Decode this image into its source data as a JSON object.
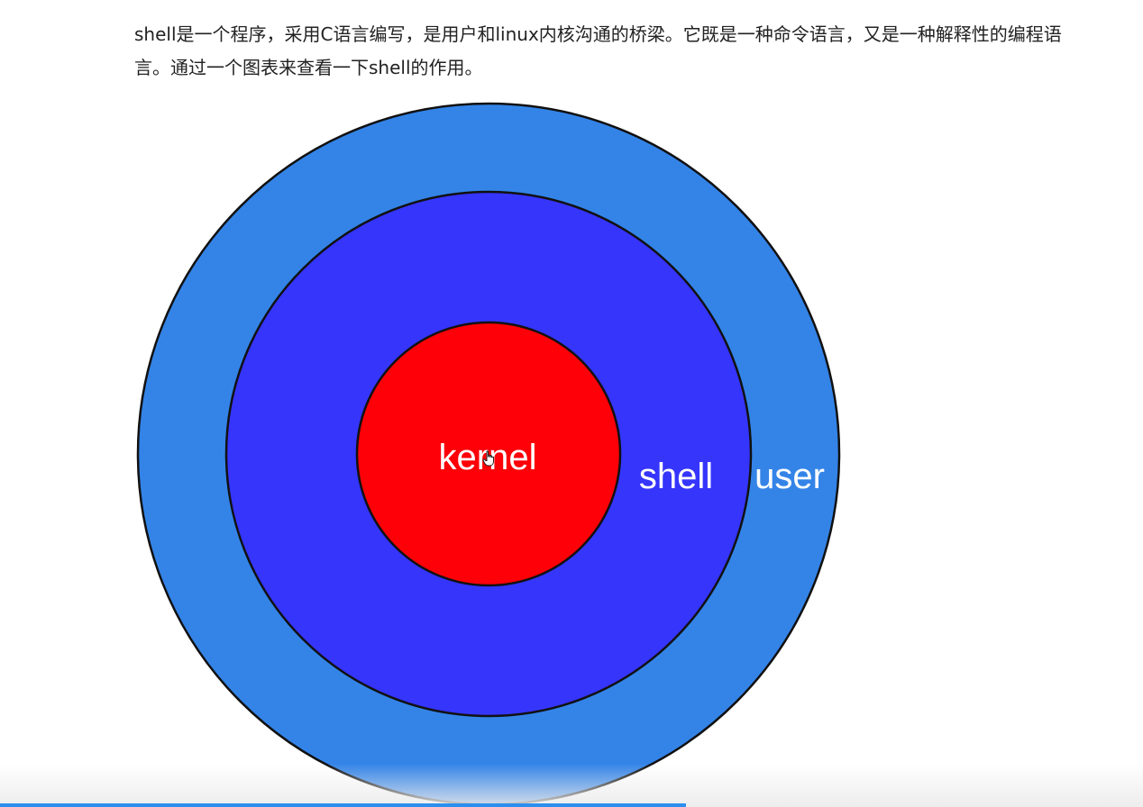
{
  "intro": {
    "text": "shell是一个程序，采用C语言编写，是用户和linux内核沟通的桥梁。它既是一种命令语言，又是一种解释性的编程语言。通过一个图表来查看一下shell的作用。"
  },
  "diagram": {
    "layers": [
      {
        "label": "user",
        "color": "#3484e8"
      },
      {
        "label": "shell",
        "color": "#3535fc"
      },
      {
        "label": "kernel",
        "color": "#fd0008"
      }
    ]
  },
  "progress": {
    "fraction": 0.6
  },
  "icons": {
    "cursor": "hand-pointer-icon"
  }
}
